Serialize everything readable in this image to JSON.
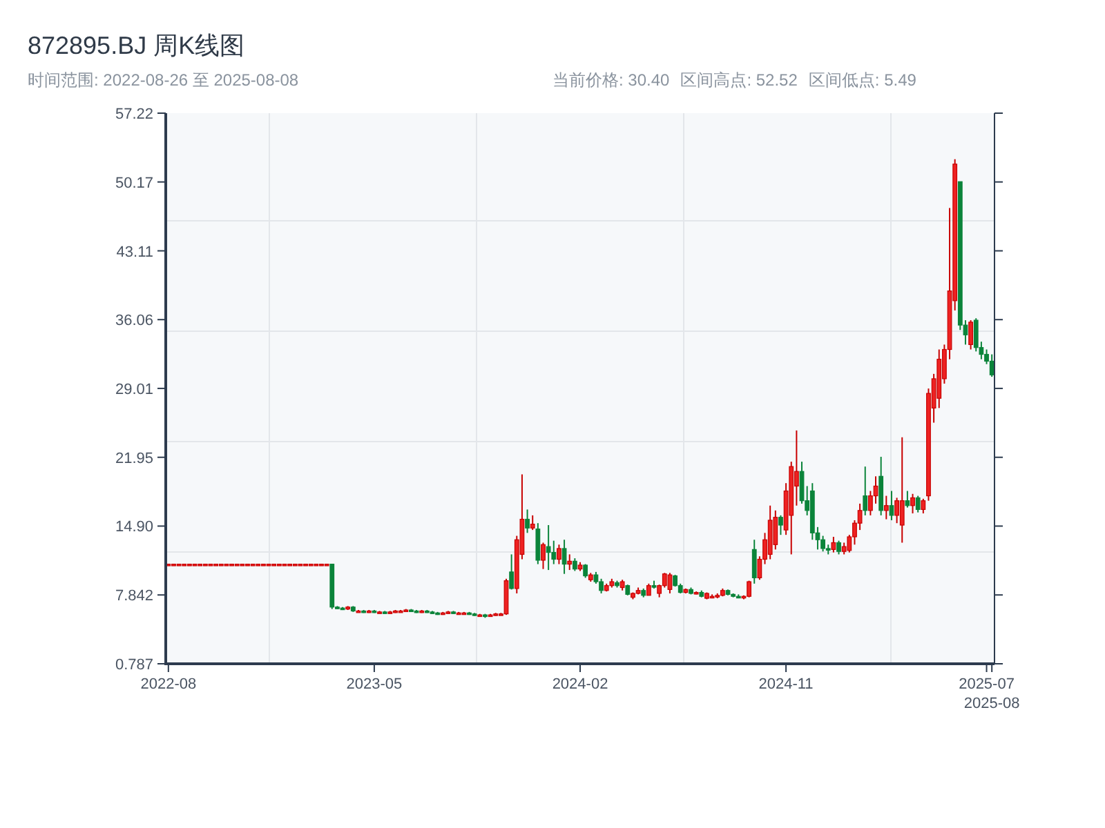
{
  "title": "872895.BJ 周K线图",
  "time_range": "时间范围: 2022-08-26 至 2025-08-08",
  "stats": [
    "当前价格: 30.40",
    "区间高点: 52.52",
    "区间低点: 5.49"
  ],
  "chart_data": {
    "type": "candlestick",
    "ylim": [
      0.787,
      57.22
    ],
    "categories": [
      "2022-08",
      null,
      null,
      null,
      null,
      null,
      null,
      null,
      null,
      null,
      null,
      null,
      null,
      null,
      null,
      null,
      null,
      null,
      null,
      null,
      null,
      null,
      null,
      null,
      null,
      null,
      null,
      null,
      null,
      null,
      null,
      null,
      null,
      null,
      null,
      null,
      null,
      null,
      null,
      "2023-05",
      null,
      null,
      null,
      null,
      null,
      null,
      null,
      null,
      null,
      null,
      null,
      null,
      null,
      null,
      null,
      null,
      null,
      null,
      null,
      null,
      null,
      null,
      null,
      null,
      null,
      null,
      null,
      null,
      null,
      null,
      null,
      null,
      null,
      null,
      null,
      null,
      null,
      null,
      "2024-02",
      null,
      null,
      null,
      null,
      null,
      null,
      null,
      null,
      null,
      null,
      null,
      null,
      null,
      null,
      null,
      null,
      null,
      null,
      null,
      null,
      null,
      null,
      null,
      null,
      null,
      null,
      null,
      null,
      null,
      null,
      null,
      null,
      null,
      null,
      null,
      null,
      null,
      null,
      "2024-11",
      null,
      null,
      null,
      null,
      null,
      null,
      null,
      null,
      null,
      null,
      null,
      null,
      null,
      null,
      null,
      null,
      null,
      null,
      null,
      null,
      null,
      null,
      null,
      null,
      null,
      null,
      null,
      null,
      null,
      null,
      null,
      null,
      null,
      null,
      null,
      null,
      null,
      "2025-07",
      "2025-08"
    ],
    "yticks": [
      {
        "value": 0.787,
        "label": "0.787"
      },
      {
        "value": 7.842,
        "label": "7.842"
      },
      {
        "value": 14.9,
        "label": "14.90"
      },
      {
        "value": 21.95,
        "label": "21.95"
      },
      {
        "value": 29.01,
        "label": "29.01"
      },
      {
        "value": 36.06,
        "label": "36.06"
      },
      {
        "value": 43.11,
        "label": "43.11"
      },
      {
        "value": 50.17,
        "label": "50.17"
      },
      {
        "value": 57.22,
        "label": "57.22"
      }
    ],
    "ohlc": [
      [
        11.0,
        11.0,
        11.0,
        11.0
      ],
      [
        11.0,
        11.0,
        11.0,
        11.0
      ],
      [
        11.0,
        11.0,
        11.0,
        11.0
      ],
      [
        11.0,
        11.0,
        11.0,
        11.0
      ],
      [
        11.0,
        11.0,
        11.0,
        11.0
      ],
      [
        11.0,
        11.0,
        11.0,
        11.0
      ],
      [
        11.0,
        11.0,
        11.0,
        11.0
      ],
      [
        11.0,
        11.0,
        11.0,
        11.0
      ],
      [
        11.0,
        11.0,
        11.0,
        11.0
      ],
      [
        11.0,
        11.0,
        11.0,
        11.0
      ],
      [
        11.0,
        11.0,
        11.0,
        11.0
      ],
      [
        11.0,
        11.0,
        11.0,
        11.0
      ],
      [
        11.0,
        11.0,
        11.0,
        11.0
      ],
      [
        11.0,
        11.0,
        11.0,
        11.0
      ],
      [
        11.0,
        11.0,
        11.0,
        11.0
      ],
      [
        11.0,
        11.0,
        11.0,
        11.0
      ],
      [
        11.0,
        11.0,
        11.0,
        11.0
      ],
      [
        11.0,
        11.0,
        11.0,
        11.0
      ],
      [
        11.0,
        11.0,
        11.0,
        11.0
      ],
      [
        11.0,
        11.0,
        11.0,
        11.0
      ],
      [
        11.0,
        11.0,
        11.0,
        11.0
      ],
      [
        11.0,
        11.0,
        11.0,
        11.0
      ],
      [
        11.0,
        11.0,
        11.0,
        11.0
      ],
      [
        11.0,
        11.0,
        11.0,
        11.0
      ],
      [
        11.0,
        11.0,
        11.0,
        11.0
      ],
      [
        11.0,
        11.0,
        11.0,
        11.0
      ],
      [
        11.0,
        11.0,
        11.0,
        11.0
      ],
      [
        11.0,
        11.0,
        11.0,
        11.0
      ],
      [
        11.0,
        11.0,
        11.0,
        11.0
      ],
      [
        11.0,
        11.0,
        11.0,
        11.0
      ],
      [
        11.0,
        11.0,
        11.0,
        11.0
      ],
      [
        11.0,
        11.0,
        6.4,
        6.6
      ],
      [
        6.6,
        6.7,
        6.4,
        6.5
      ],
      [
        6.5,
        6.6,
        6.3,
        6.4
      ],
      [
        6.4,
        6.7,
        6.3,
        6.6
      ],
      [
        6.6,
        6.7,
        6.1,
        6.2
      ],
      [
        6.2,
        6.3,
        6.1,
        6.2
      ],
      [
        6.2,
        6.3,
        6.0,
        6.1
      ],
      [
        6.1,
        6.3,
        6.0,
        6.2
      ],
      [
        6.2,
        6.3,
        6.0,
        6.1
      ],
      [
        6.1,
        6.2,
        6.0,
        6.1
      ],
      [
        6.1,
        6.2,
        5.9,
        6.0
      ],
      [
        6.0,
        6.2,
        5.9,
        6.1
      ],
      [
        6.1,
        6.3,
        6.0,
        6.2
      ],
      [
        6.2,
        6.3,
        6.1,
        6.2
      ],
      [
        6.2,
        6.4,
        6.1,
        6.3
      ],
      [
        6.3,
        6.4,
        6.1,
        6.2
      ],
      [
        6.2,
        6.3,
        6.0,
        6.1
      ],
      [
        6.1,
        6.3,
        6.0,
        6.2
      ],
      [
        6.2,
        6.3,
        6.0,
        6.1
      ],
      [
        6.1,
        6.2,
        5.9,
        6.0
      ],
      [
        6.0,
        6.1,
        5.8,
        5.9
      ],
      [
        5.9,
        6.1,
        5.8,
        6.0
      ],
      [
        6.0,
        6.2,
        5.9,
        6.1
      ],
      [
        6.1,
        6.2,
        5.9,
        6.0
      ],
      [
        6.0,
        6.1,
        5.9,
        6.0
      ],
      [
        6.0,
        6.1,
        5.9,
        6.0
      ],
      [
        6.0,
        6.1,
        5.8,
        5.9
      ],
      [
        5.9,
        6.0,
        5.7,
        5.8
      ],
      [
        5.8,
        5.9,
        5.7,
        5.8
      ],
      [
        5.8,
        5.9,
        5.5,
        5.7
      ],
      [
        5.7,
        5.9,
        5.6,
        5.8
      ],
      [
        5.8,
        6.0,
        5.7,
        5.9
      ],
      [
        5.9,
        6.0,
        5.8,
        5.9
      ],
      [
        5.9,
        9.5,
        5.8,
        9.3
      ],
      [
        10.2,
        12.0,
        8.4,
        8.5
      ],
      [
        8.5,
        13.9,
        8.0,
        13.5
      ],
      [
        12.0,
        20.2,
        11.5,
        15.6
      ],
      [
        15.6,
        16.6,
        14.2,
        14.7
      ],
      [
        14.7,
        16.0,
        14.5,
        15.1
      ],
      [
        14.6,
        15.2,
        11.0,
        11.4
      ],
      [
        11.4,
        13.2,
        10.5,
        13.0
      ],
      [
        12.8,
        15.0,
        10.4,
        12.2
      ],
      [
        12.2,
        13.4,
        11.0,
        11.5
      ],
      [
        11.5,
        13.0,
        11.0,
        12.6
      ],
      [
        12.6,
        13.5,
        10.0,
        11.0
      ],
      [
        11.0,
        12.0,
        10.4,
        11.3
      ],
      [
        11.3,
        11.6,
        10.3,
        10.5
      ],
      [
        10.5,
        11.2,
        10.3,
        10.9
      ],
      [
        10.9,
        11.0,
        9.6,
        9.8
      ],
      [
        9.4,
        10.1,
        9.2,
        9.9
      ],
      [
        9.9,
        10.2,
        9.0,
        9.2
      ],
      [
        9.2,
        9.5,
        8.0,
        8.3
      ],
      [
        8.3,
        9.0,
        8.2,
        8.8
      ],
      [
        8.8,
        9.5,
        8.6,
        9.2
      ],
      [
        9.1,
        9.3,
        8.6,
        8.8
      ],
      [
        8.6,
        9.4,
        8.3,
        9.2
      ],
      [
        8.8,
        8.9,
        7.8,
        7.9
      ],
      [
        7.6,
        8.1,
        7.4,
        8.0
      ],
      [
        8.0,
        8.6,
        7.9,
        8.3
      ],
      [
        8.3,
        8.5,
        7.6,
        7.8
      ],
      [
        7.8,
        9.0,
        7.8,
        8.8
      ],
      [
        8.8,
        9.3,
        8.5,
        8.7
      ],
      [
        8.0,
        8.9,
        7.6,
        8.8
      ],
      [
        8.8,
        10.1,
        8.6,
        10.0
      ],
      [
        8.4,
        10.1,
        8.0,
        9.9
      ],
      [
        9.8,
        9.9,
        8.7,
        8.8
      ],
      [
        8.8,
        9.0,
        8.0,
        8.1
      ],
      [
        8.1,
        8.5,
        8.0,
        8.4
      ],
      [
        8.4,
        8.6,
        7.9,
        8.0
      ],
      [
        8.0,
        8.2,
        7.9,
        8.1
      ],
      [
        8.1,
        8.3,
        7.6,
        7.7
      ],
      [
        7.5,
        8.1,
        7.4,
        8.0
      ],
      [
        7.6,
        7.9,
        7.5,
        7.7
      ],
      [
        7.7,
        8.0,
        7.5,
        7.8
      ],
      [
        7.8,
        8.5,
        7.7,
        8.3
      ],
      [
        8.3,
        8.4,
        7.8,
        7.9
      ],
      [
        7.9,
        8.0,
        7.6,
        7.7
      ],
      [
        7.7,
        7.9,
        7.5,
        7.6
      ],
      [
        7.6,
        7.8,
        7.4,
        7.7
      ],
      [
        7.7,
        9.3,
        7.6,
        9.2
      ],
      [
        12.5,
        13.5,
        9.0,
        9.6
      ],
      [
        9.6,
        11.8,
        9.4,
        11.5
      ],
      [
        11.5,
        14.2,
        11.0,
        13.5
      ],
      [
        12.0,
        17.0,
        11.5,
        15.5
      ],
      [
        13.0,
        16.5,
        12.5,
        15.8
      ],
      [
        15.8,
        16.0,
        14.0,
        15.0
      ],
      [
        14.5,
        19.3,
        14.0,
        18.5
      ],
      [
        16.0,
        21.5,
        12.0,
        21.0
      ],
      [
        19.0,
        24.7,
        17.0,
        20.5
      ],
      [
        20.5,
        21.5,
        17.2,
        17.5
      ],
      [
        17.5,
        19.0,
        16.0,
        16.5
      ],
      [
        18.5,
        19.3,
        13.5,
        14.2
      ],
      [
        14.2,
        14.8,
        12.5,
        13.5
      ],
      [
        13.5,
        13.9,
        12.3,
        12.6
      ],
      [
        12.6,
        13.0,
        12.0,
        12.5
      ],
      [
        12.5,
        13.8,
        12.2,
        13.2
      ],
      [
        13.2,
        13.4,
        12.0,
        12.3
      ],
      [
        12.3,
        13.2,
        12.0,
        12.8
      ],
      [
        12.4,
        14.0,
        12.2,
        13.8
      ],
      [
        13.8,
        15.5,
        13.0,
        15.2
      ],
      [
        15.2,
        17.2,
        14.5,
        16.5
      ],
      [
        18.0,
        21.0,
        16.0,
        16.5
      ],
      [
        16.5,
        18.5,
        16.0,
        18.0
      ],
      [
        18.0,
        20.0,
        17.2,
        19.0
      ],
      [
        20.0,
        22.0,
        16.0,
        16.5
      ],
      [
        16.5,
        18.0,
        15.6,
        17.0
      ],
      [
        17.0,
        18.5,
        15.5,
        16.0
      ],
      [
        16.0,
        17.8,
        15.2,
        17.5
      ],
      [
        15.0,
        24.0,
        13.2,
        17.5
      ],
      [
        17.5,
        18.5,
        16.8,
        17.0
      ],
      [
        17.0,
        18.2,
        16.2,
        17.8
      ],
      [
        17.8,
        18.0,
        16.3,
        16.6
      ],
      [
        16.6,
        17.7,
        16.2,
        17.5
      ],
      [
        18.0,
        29.0,
        17.5,
        28.5
      ],
      [
        27.0,
        30.5,
        25.5,
        30.0
      ],
      [
        28.0,
        33.0,
        27.0,
        32.0
      ],
      [
        30.0,
        33.5,
        29.5,
        33.0
      ],
      [
        33.0,
        47.5,
        32.0,
        39.0
      ],
      [
        38.0,
        52.5,
        37.0,
        52.0
      ],
      [
        50.2,
        50.2,
        35.0,
        35.5
      ],
      [
        35.5,
        36.0,
        33.5,
        34.5
      ],
      [
        33.5,
        36.0,
        33.0,
        35.8
      ],
      [
        36.0,
        36.2,
        32.8,
        33.2
      ],
      [
        33.2,
        33.8,
        32.0,
        32.5
      ],
      [
        32.5,
        33.0,
        31.5,
        31.8
      ],
      [
        31.8,
        32.5,
        30.2,
        30.4
      ]
    ]
  }
}
